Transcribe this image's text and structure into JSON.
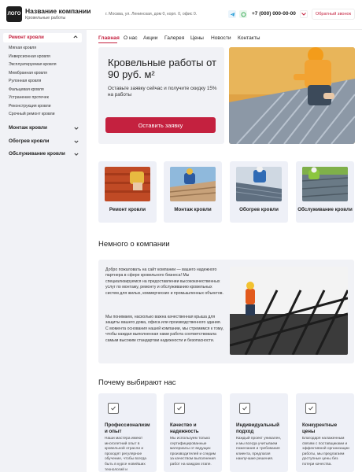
{
  "header": {
    "logo_text": "ЛОГО",
    "company_name": "Название компании",
    "company_sub": "Кровельные работы",
    "address": "г. Москва, ул. Ленинская, дом 0, корп. 0, офис 0.",
    "phone": "+7 (000) 000-00-00",
    "callback_label": "Обратный звонок"
  },
  "sidebar": {
    "active_label": "Ремонт кровли",
    "subitems": [
      "Мягкая кровля",
      "Инверсионная кровля",
      "Эксплуатируемая кровля",
      "Мембранная кровля",
      "Рулонная кровля",
      "Фальцевая кровля",
      "Устранение протечек",
      "Реконструкция кровли",
      "Срочный ремонт кровли"
    ],
    "categories": [
      "Монтаж кровли",
      "Обогрев кровли",
      "Обслуживание кровли"
    ]
  },
  "nav": [
    "Главная",
    "О нас",
    "Акции",
    "Галерея",
    "Цены",
    "Новости",
    "Контакты"
  ],
  "hero": {
    "title": "Кровельные работы от 90 руб. м²",
    "text": "Оставьте заявку сейчас и получите скидку 15% на работы",
    "button": "Оставить заявку"
  },
  "services": [
    "Ремонт кровли",
    "Монтаж кровли",
    "Обогрев кровли",
    "Обслуживание кровли"
  ],
  "about": {
    "heading": "Немного о компании",
    "p1": "Добро пожаловать на сайт компании — вашего надежного партнера в сфере кровельного бизнеса! Мы специализируемся на предоставлении высококачественных услуг по монтажу, ремонту и обслуживанию кровельных систем для жилых, коммерческих и промышленных объектов.",
    "p2": "Мы понимаем, насколько важна качественная крыша для защиты вашего дома, офиса или производственного здания. С момента основания нашей компании, мы стремимся к тому, чтобы каждая выполненная нами работа соответствовала самым высоким стандартам надежности и безопасности."
  },
  "why": {
    "heading": "Почему выбирают нас",
    "cards": [
      {
        "title": "Профессионализм и опыт",
        "text": "Наши мастера имеют многолетний опыт в кровельной отрасли и проходят регулярное обучение, чтобы всегда быть в курсе новейших технологий и"
      },
      {
        "title": "Качество и надежность",
        "text": "Мы используем только сертифицированные материалы от ведущих производителей и следим за качеством выполнения работ на каждом этапе."
      },
      {
        "title": "Индивидуальный подход",
        "text": "Каждый проект уникален, и мы всегда учитываем пожелания и требования клиента, предлагая наилучшие решения."
      },
      {
        "title": "Конкурентные цены",
        "text": "Благодаря налаженным связям с поставщиками и эффективной организации работы, мы предлагаем доступные цены без потери качества."
      }
    ]
  },
  "colors": {
    "accent": "#c4213f",
    "panel": "#f1f2f6",
    "card": "#eef0f7"
  }
}
